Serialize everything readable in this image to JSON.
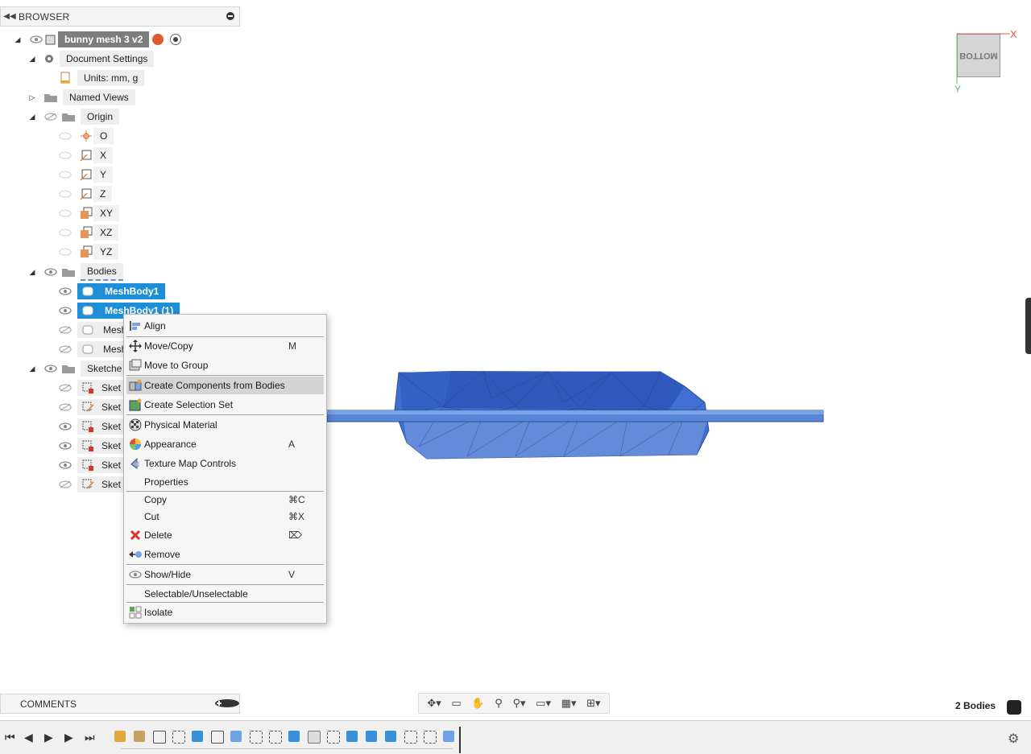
{
  "browser": {
    "title": "BROWSER",
    "root": "bunny mesh 3 v2",
    "document_settings": "Document Settings",
    "units": "Units: mm, g",
    "named_views": "Named Views",
    "origin": {
      "label": "Origin",
      "items": [
        "O",
        "X",
        "Y",
        "Z",
        "XY",
        "XZ",
        "YZ"
      ]
    },
    "bodies": {
      "label": "Bodies",
      "items": [
        "MeshBody1",
        "MeshBody1 (1)",
        "Mesh",
        "Mesh"
      ]
    },
    "sketches": {
      "label": "Sketche",
      "items": [
        "Sket",
        "Sket",
        "Sket",
        "Sket",
        "Sket",
        "Sket"
      ]
    }
  },
  "context_menu": {
    "items": [
      {
        "label": "Align",
        "shortcut": "",
        "icon": "align-icon"
      },
      {
        "label": "Move/Copy",
        "shortcut": "M",
        "icon": "move-icon"
      },
      {
        "label": "Move to Group",
        "shortcut": "",
        "icon": "move-to-group-icon"
      },
      {
        "label": "Create Components from Bodies",
        "shortcut": "",
        "icon": "components-icon"
      },
      {
        "label": "Create Selection Set",
        "shortcut": "",
        "icon": "selection-set-icon"
      },
      {
        "label": "Physical Material",
        "shortcut": "",
        "icon": "material-icon"
      },
      {
        "label": "Appearance",
        "shortcut": "A",
        "icon": "appearance-icon"
      },
      {
        "label": "Texture Map Controls",
        "shortcut": "",
        "icon": "texture-icon"
      },
      {
        "label": "Properties",
        "shortcut": ""
      },
      {
        "label": "Copy",
        "shortcut": "⌘C"
      },
      {
        "label": "Cut",
        "shortcut": "⌘X"
      },
      {
        "label": "Delete",
        "shortcut": "⌦",
        "icon": "delete-icon"
      },
      {
        "label": "Remove",
        "shortcut": "",
        "icon": "remove-icon"
      },
      {
        "label": "Show/Hide",
        "shortcut": "V",
        "icon": "eye-icon"
      },
      {
        "label": "Selectable/Unselectable",
        "shortcut": ""
      },
      {
        "label": "Isolate",
        "shortcut": "",
        "icon": "isolate-icon"
      }
    ]
  },
  "comments": {
    "title": "COMMENTS"
  },
  "status": {
    "bodies_count": "2 Bodies"
  },
  "viewcube": {
    "face": "BOTTOM",
    "x_axis": "X",
    "y_axis": "Y"
  },
  "colors": {
    "selection": "#1d8fd8",
    "mesh": "#3f6fd1",
    "menu_highlight": "#d4d4d4"
  }
}
